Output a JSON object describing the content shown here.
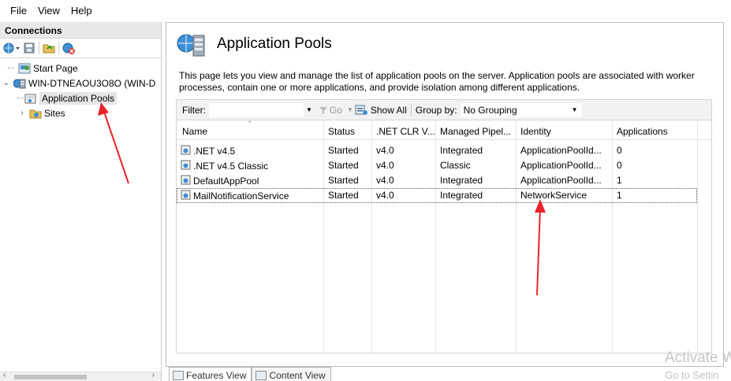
{
  "menu": {
    "items": [
      "File",
      "View",
      "Help"
    ]
  },
  "connections": {
    "title": "Connections",
    "tree": {
      "start_page": "Start Page",
      "server": "WIN-DTNEAOU3O8O (WIN-D",
      "app_pools": "Application Pools",
      "sites": "Sites"
    }
  },
  "main": {
    "title": "Application Pools",
    "description": "This page lets you view and manage the list of application pools on the server. Application pools are associated with worker processes, contain one or more applications, and provide isolation among different applications.",
    "filter": {
      "label": "Filter:",
      "value": "",
      "go_label": "Go",
      "show_all_label": "Show All",
      "group_by_label": "Group by:",
      "group_by_value": "No Grouping"
    },
    "columns": [
      "Name",
      "Status",
      ".NET CLR V...",
      "Managed Pipel...",
      "Identity",
      "Applications"
    ],
    "rows": [
      {
        "name": ".NET v4.5",
        "status": "Started",
        "clr": "v4.0",
        "pipeline": "Integrated",
        "identity": "ApplicationPoolId...",
        "apps": "0"
      },
      {
        "name": ".NET v4.5 Classic",
        "status": "Started",
        "clr": "v4.0",
        "pipeline": "Classic",
        "identity": "ApplicationPoolId...",
        "apps": "0"
      },
      {
        "name": "DefaultAppPool",
        "status": "Started",
        "clr": "v4.0",
        "pipeline": "Integrated",
        "identity": "ApplicationPoolId...",
        "apps": "1"
      },
      {
        "name": "MailNotificationService",
        "status": "Started",
        "clr": "v4.0",
        "pipeline": "Integrated",
        "identity": "NetworkService",
        "apps": "1"
      }
    ],
    "selected_row": 3
  },
  "tabs": {
    "features_view": "Features View",
    "content_view": "Content View"
  },
  "watermark": {
    "line1": "Activate W",
    "line2": "Go to Settin"
  },
  "colors": {
    "annotation_arrow": "#e8232a",
    "selection_bg": "#e5e5e5"
  },
  "icons": [
    "globe-connect-icon",
    "save-icon",
    "folder-icon",
    "disconnect-icon",
    "start-page-icon",
    "server-icon",
    "app-pool-icon",
    "sites-folder-icon",
    "app-pools-large-icon",
    "filter-funnel-icon",
    "show-all-icon"
  ]
}
